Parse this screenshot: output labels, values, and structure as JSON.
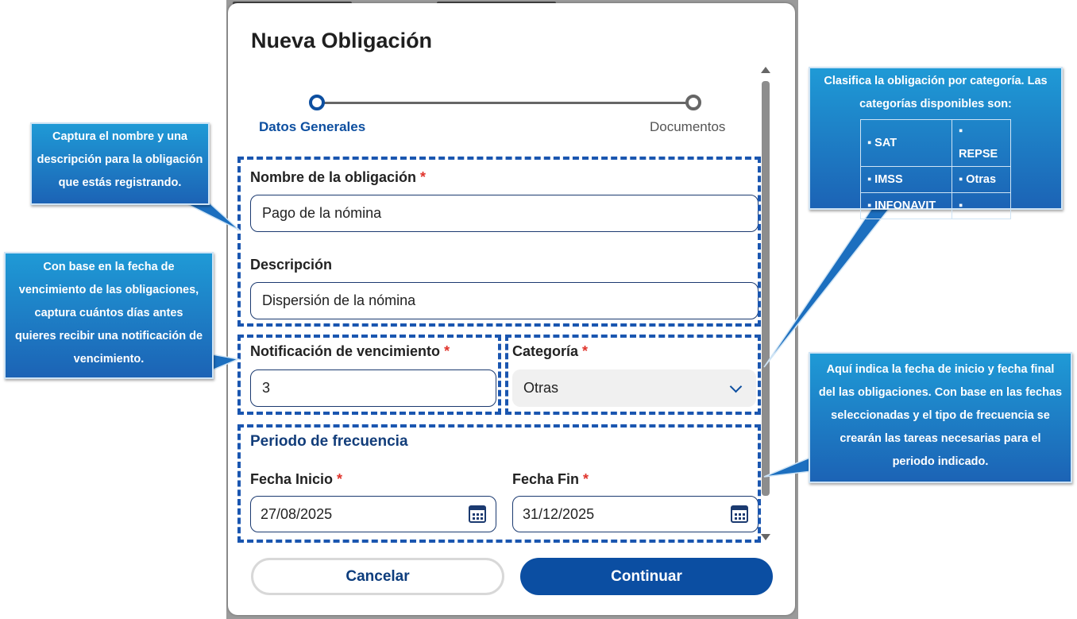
{
  "dialog": {
    "title": "Nueva Obligación",
    "steps": [
      {
        "label": "Datos Generales",
        "state": "active"
      },
      {
        "label": "Documentos",
        "state": "inactive"
      }
    ]
  },
  "form": {
    "name": {
      "label": "Nombre de la obligación",
      "required_mark": "*",
      "value": "Pago de la nómina"
    },
    "description": {
      "label": "Descripción",
      "value": "Dispersión de la nómina"
    },
    "notification": {
      "label": "Notificación de vencimiento",
      "required_mark": "*",
      "value": "3"
    },
    "category": {
      "label": "Categoría",
      "required_mark": "*",
      "selected": "Otras",
      "icon": "chevron-down-icon"
    },
    "frequency_section_title": "Periodo de frecuencia",
    "start_date": {
      "label": "Fecha Inicio",
      "required_mark": "*",
      "value": "27/08/2025",
      "icon": "calendar-icon"
    },
    "end_date": {
      "label": "Fecha Fin",
      "required_mark": "*",
      "value": "31/12/2025",
      "icon": "calendar-icon"
    }
  },
  "buttons": {
    "cancel": "Cancelar",
    "continue": "Continuar"
  },
  "callouts": {
    "name_description": {
      "lines": [
        "Captura el nombre y una",
        "descripción para la obligación",
        "que estás registrando."
      ]
    },
    "notification": {
      "lines": [
        "Con base en la fecha de",
        "vencimiento de las obligaciones,",
        "captura cuántos días antes",
        "quieres recibir una notificación de",
        "vencimiento."
      ]
    },
    "category": {
      "lines": [
        "Clasifica la obligación por categoría. Las",
        "categorías disponibles son:"
      ],
      "table": [
        [
          "▪ SAT",
          "▪ REPSE"
        ],
        [
          "▪ IMSS",
          "▪ Otras"
        ],
        [
          "▪ INFONAVIT",
          "▪"
        ]
      ]
    },
    "dates": {
      "lines": [
        "Aquí indica la fecha de inicio y fecha final",
        "del las obligaciones. Con base en las fechas",
        "seleccionadas y el tipo de frecuencia se",
        "crearán las tareas necesarias para el",
        "periodo indicado."
      ]
    }
  },
  "colors": {
    "primary": "#0b4ea2",
    "callout_top": "#1f9ad6",
    "callout_bottom": "#1c63b5",
    "required": "#e0342c",
    "highlight": "#1a56b0"
  }
}
